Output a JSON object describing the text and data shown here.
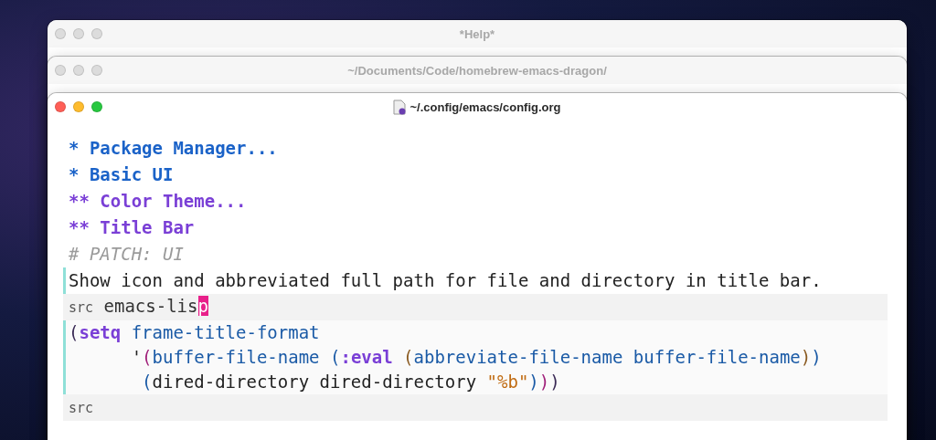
{
  "windows": [
    {
      "title": "*Help*",
      "focused": false,
      "file_icon": false
    },
    {
      "title": "~/Documents/Code/homebrew-emacs-dragon/",
      "focused": false,
      "file_icon": false
    },
    {
      "title": "~/.config/emacs/config.org",
      "focused": true,
      "file_icon": true
    }
  ],
  "buffer": {
    "lines": [
      {
        "kind": "h1",
        "text": "* Package Manager..."
      },
      {
        "kind": "h1",
        "text": "* Basic UI"
      },
      {
        "kind": "h2",
        "text": "** Color Theme..."
      },
      {
        "kind": "h2",
        "text": "** Title Bar"
      },
      {
        "kind": "comment",
        "text": "# PATCH: UI"
      },
      {
        "kind": "text",
        "text": "Show icon and abbreviated full path for file and directory in title bar."
      }
    ],
    "src_block": {
      "begin_keyword": "src",
      "language": "emacs-lis",
      "cursor_char": "p",
      "code": [
        [
          {
            "kind": "paren-a",
            "text": "("
          },
          {
            "kind": "keyword",
            "text": "setq"
          },
          {
            "kind": "name",
            "text": " frame-title-format"
          }
        ],
        [
          {
            "kind": "plain",
            "text": "      '"
          },
          {
            "kind": "paren-b",
            "text": "("
          },
          {
            "kind": "name",
            "text": "buffer-file-name "
          },
          {
            "kind": "paren-c",
            "text": "("
          },
          {
            "kind": "keyword",
            "text": ":eval "
          },
          {
            "kind": "paren-d",
            "text": "("
          },
          {
            "kind": "name",
            "text": "abbreviate-file-name buffer-file-name"
          },
          {
            "kind": "paren-d",
            "text": ")"
          },
          {
            "kind": "paren-c",
            "text": ")"
          }
        ],
        [
          {
            "kind": "paren-c",
            "text": "       ("
          },
          {
            "kind": "plain",
            "text": "dired-directory dired-directory "
          },
          {
            "kind": "string",
            "text": "\"%b\""
          },
          {
            "kind": "paren-c",
            "text": ")"
          },
          {
            "kind": "paren-b",
            "text": ")"
          },
          {
            "kind": "paren-a",
            "text": ")"
          }
        ]
      ],
      "end_keyword": "src"
    }
  }
}
